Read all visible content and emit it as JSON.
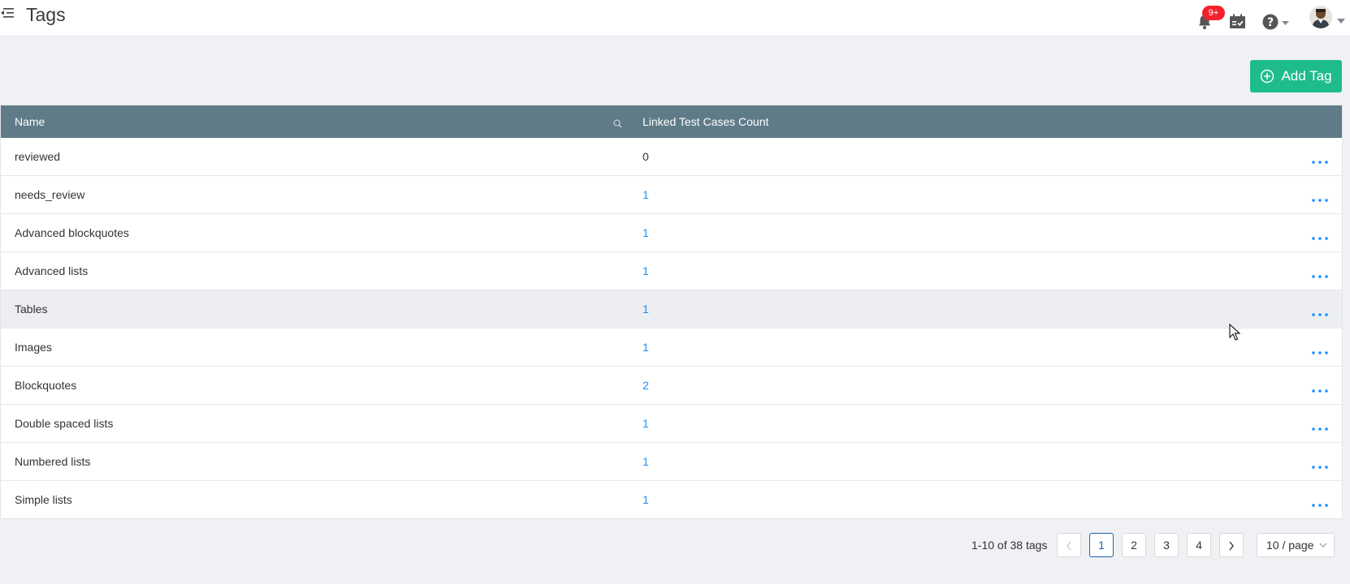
{
  "header": {
    "title": "Tags",
    "notification_badge": "9+",
    "icons": [
      "menu-fold-icon",
      "bell-icon",
      "calendar-check-icon",
      "help-icon",
      "avatar"
    ]
  },
  "toolbar": {
    "add_label": "Add Tag"
  },
  "table": {
    "columns": [
      "Name",
      "Linked Test Cases Count"
    ],
    "rows": [
      {
        "name": "reviewed",
        "count": "0"
      },
      {
        "name": "needs_review",
        "count": "1"
      },
      {
        "name": "Advanced blockquotes",
        "count": "1"
      },
      {
        "name": "Advanced lists",
        "count": "1"
      },
      {
        "name": "Tables",
        "count": "1"
      },
      {
        "name": "Images",
        "count": "1"
      },
      {
        "name": "Blockquotes",
        "count": "2"
      },
      {
        "name": "Double spaced lists",
        "count": "1"
      },
      {
        "name": "Numbered lists",
        "count": "1"
      },
      {
        "name": "Simple lists",
        "count": "1"
      }
    ]
  },
  "pagination": {
    "total_text": "1-10 of 38 tags",
    "pages": [
      "1",
      "2",
      "3",
      "4"
    ],
    "current": "1",
    "page_size": "10 / page"
  },
  "colors": {
    "accent": "#1fbc8b",
    "header_bg": "#5f7b88",
    "link": "#1890ff",
    "badge": "#f5222d"
  }
}
